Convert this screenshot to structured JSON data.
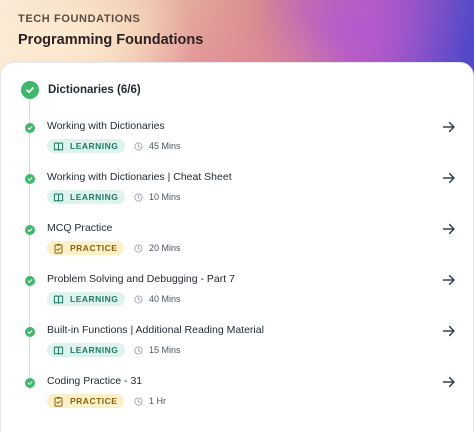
{
  "header": {
    "category": "TECH FOUNDATIONS",
    "course_title": "Programming Foundations"
  },
  "section": {
    "title": "Dictionaries (6/6)",
    "status_icon": "check-circle-icon"
  },
  "items": [
    {
      "title": "Working with Dictionaries",
      "type": "LEARNING",
      "duration": "45 Mins",
      "completed": true
    },
    {
      "title": "Working with Dictionaries | Cheat Sheet",
      "type": "LEARNING",
      "duration": "10 Mins",
      "completed": true
    },
    {
      "title": "MCQ Practice",
      "type": "PRACTICE",
      "duration": "20 Mins",
      "completed": true
    },
    {
      "title": "Problem Solving and Debugging - Part 7",
      "type": "LEARNING",
      "duration": "40 Mins",
      "completed": true
    },
    {
      "title": "Built-in Functions | Additional Reading Material",
      "type": "LEARNING",
      "duration": "15 Mins",
      "completed": true
    },
    {
      "title": "Coding Practice - 31",
      "type": "PRACTICE",
      "duration": "1 Hr",
      "completed": true
    }
  ],
  "colors": {
    "success": "#3fb86b",
    "learning_bg": "#dff3ee",
    "learning_text": "#1f7a66",
    "practice_bg": "#fbf0c7",
    "practice_text": "#8a6410"
  },
  "icons": {
    "learning": "book-icon",
    "practice": "clipboard-icon",
    "duration": "clock-icon",
    "open": "arrow-right-icon"
  }
}
